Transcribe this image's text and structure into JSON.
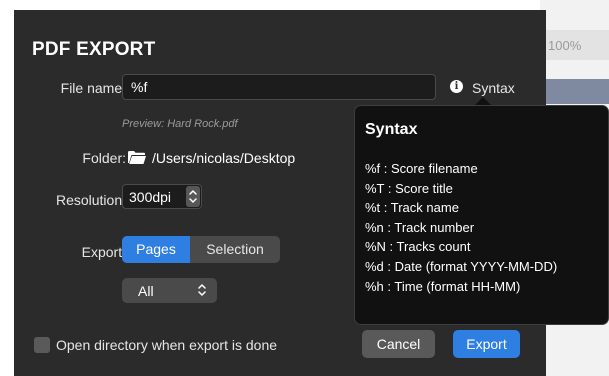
{
  "background_app": {
    "zoom_label": "100%"
  },
  "dialog": {
    "title": "PDF EXPORT",
    "file_name": {
      "label": "File name:",
      "value": "%f"
    },
    "syntax_link": "Syntax",
    "preview": "Preview: Hard Rock.pdf",
    "folder": {
      "label": "Folder:",
      "path": "/Users/nicolas/Desktop",
      "icon": "folder-icon"
    },
    "resolution": {
      "label": "Resolution:",
      "value": "300dpi"
    },
    "export": {
      "label": "Export:",
      "options": [
        "Pages",
        "Selection"
      ],
      "selected": "Pages"
    },
    "pages_select": {
      "value": "All"
    },
    "open_directory": {
      "label": "Open directory when export is done",
      "checked": false
    },
    "buttons": {
      "cancel": "Cancel",
      "export": "Export"
    }
  },
  "tooltip": {
    "title": "Syntax",
    "items": [
      "%f : Score filename",
      "%T : Score title",
      "%t : Track name",
      "%n : Track number",
      "%N : Tracks count",
      "%d : Date (format YYYY-MM-DD)",
      "%h : Time (format HH-MM)"
    ]
  },
  "colors": {
    "dialog_bg": "#2b2b2b",
    "accent": "#2f7fe3",
    "tooltip_bg": "#111111"
  }
}
